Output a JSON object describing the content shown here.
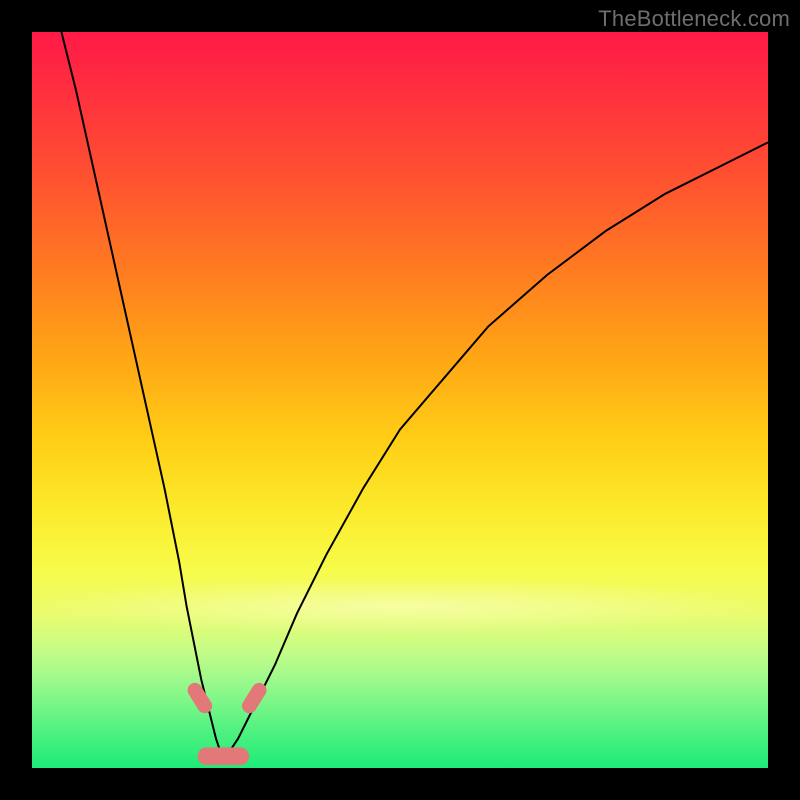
{
  "watermark": "TheBottleneck.com",
  "colors": {
    "frame": "#000000",
    "curve_stroke": "#000000",
    "marker_fill": "#e27878",
    "gradient_top": "#ff1a47",
    "gradient_bottom": "#1deb79"
  },
  "chart_data": {
    "type": "line",
    "title": "",
    "xlabel": "",
    "ylabel": "",
    "xlim": [
      0,
      100
    ],
    "ylim": [
      0,
      100
    ],
    "grid": false,
    "legend": false,
    "note": "Two V-shaped bottleneck curves over a red→green vertical gradient. Values estimated from pixel positions; axes unlabeled in source image, so x and y are normalized 0–100 within the plot area (y=0 at bottom).",
    "vertex_x": 26,
    "series": [
      {
        "name": "left-curve",
        "x": [
          4,
          6,
          8,
          10,
          12,
          14,
          16,
          18,
          20,
          21,
          22,
          23,
          24,
          25,
          26
        ],
        "y": [
          100,
          92,
          83,
          74,
          65,
          56,
          47,
          38,
          28,
          22,
          17,
          12,
          8,
          4,
          1
        ]
      },
      {
        "name": "right-curve",
        "x": [
          26,
          28,
          30,
          33,
          36,
          40,
          45,
          50,
          56,
          62,
          70,
          78,
          86,
          94,
          100
        ],
        "y": [
          1,
          4,
          8,
          14,
          21,
          29,
          38,
          46,
          53,
          60,
          67,
          73,
          78,
          82,
          85
        ]
      }
    ],
    "markers": {
      "description": "Pink rounded markers near the curve vertex",
      "points": [
        {
          "x": 22.8,
          "y": 9.5,
          "w": 2.0,
          "h": 4.5,
          "rot": -32
        },
        {
          "x": 30.2,
          "y": 9.5,
          "w": 2.0,
          "h": 4.5,
          "rot": 32
        },
        {
          "x": 26.0,
          "y": 1.6,
          "w": 7.0,
          "h": 2.4,
          "rot": 0
        }
      ]
    }
  }
}
